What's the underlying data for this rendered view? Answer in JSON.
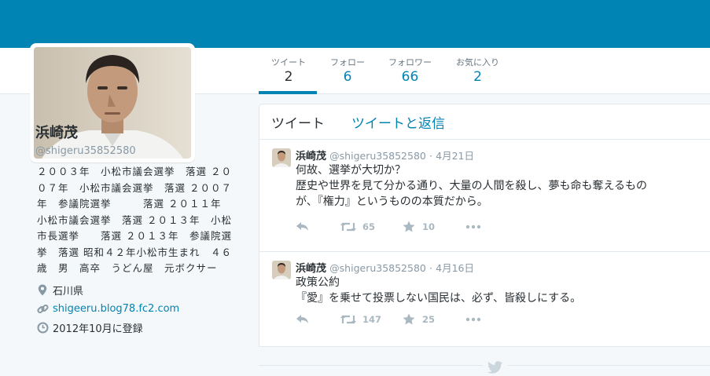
{
  "colors": {
    "header": "#0084b4",
    "link": "#0084b4",
    "muted": "#8899a6",
    "action": "#aab8c2"
  },
  "nav": [
    {
      "label": "ツイート",
      "value": "2",
      "active": true
    },
    {
      "label": "フォロー",
      "value": "6"
    },
    {
      "label": "フォロワー",
      "value": "66"
    },
    {
      "label": "お気に入り",
      "value": "2"
    }
  ],
  "profile": {
    "name": "浜崎茂",
    "handle": "@shigeru35852580",
    "bio": [
      "２００３年　小松市議会選挙　落選 ２０",
      "０７年　小松市議会選挙　落選 ２００７",
      "年　参議院選挙　　　落選 ２０１１年",
      "小松市議会選挙　落選 ２０１３年　小松",
      "市長選挙　　落選 ２０１３年　参議院選",
      "挙　落選 昭和４２年小松市生まれ　４６",
      "歳　男　高卒　うどん屋　元ボクサー"
    ],
    "location": "石川県",
    "url": "shigeeru.blog78.fc2.com",
    "joined": "2012年10月に登録"
  },
  "timeline": {
    "tabs": [
      "ツイート",
      "ツイートと返信"
    ],
    "tweets": [
      {
        "name": "浜崎茂",
        "handle": "@shigeru35852580",
        "sep": "·",
        "date": "4月21日",
        "lines": [
          "何故、選挙が大切か？",
          "歴史や世界を見て分かる通り、大量の人間を殺し、夢も命も奪えるもの",
          "が、『権力』というものの本質だから。"
        ],
        "retweets": "65",
        "favorites": "10"
      },
      {
        "name": "浜崎茂",
        "handle": "@shigeru35852580",
        "sep": "·",
        "date": "4月16日",
        "lines": [
          "政策公約",
          "『愛』を乗せて投票しない国民は、必ず、皆殺しにする。"
        ],
        "retweets": "147",
        "favorites": "25"
      }
    ]
  }
}
